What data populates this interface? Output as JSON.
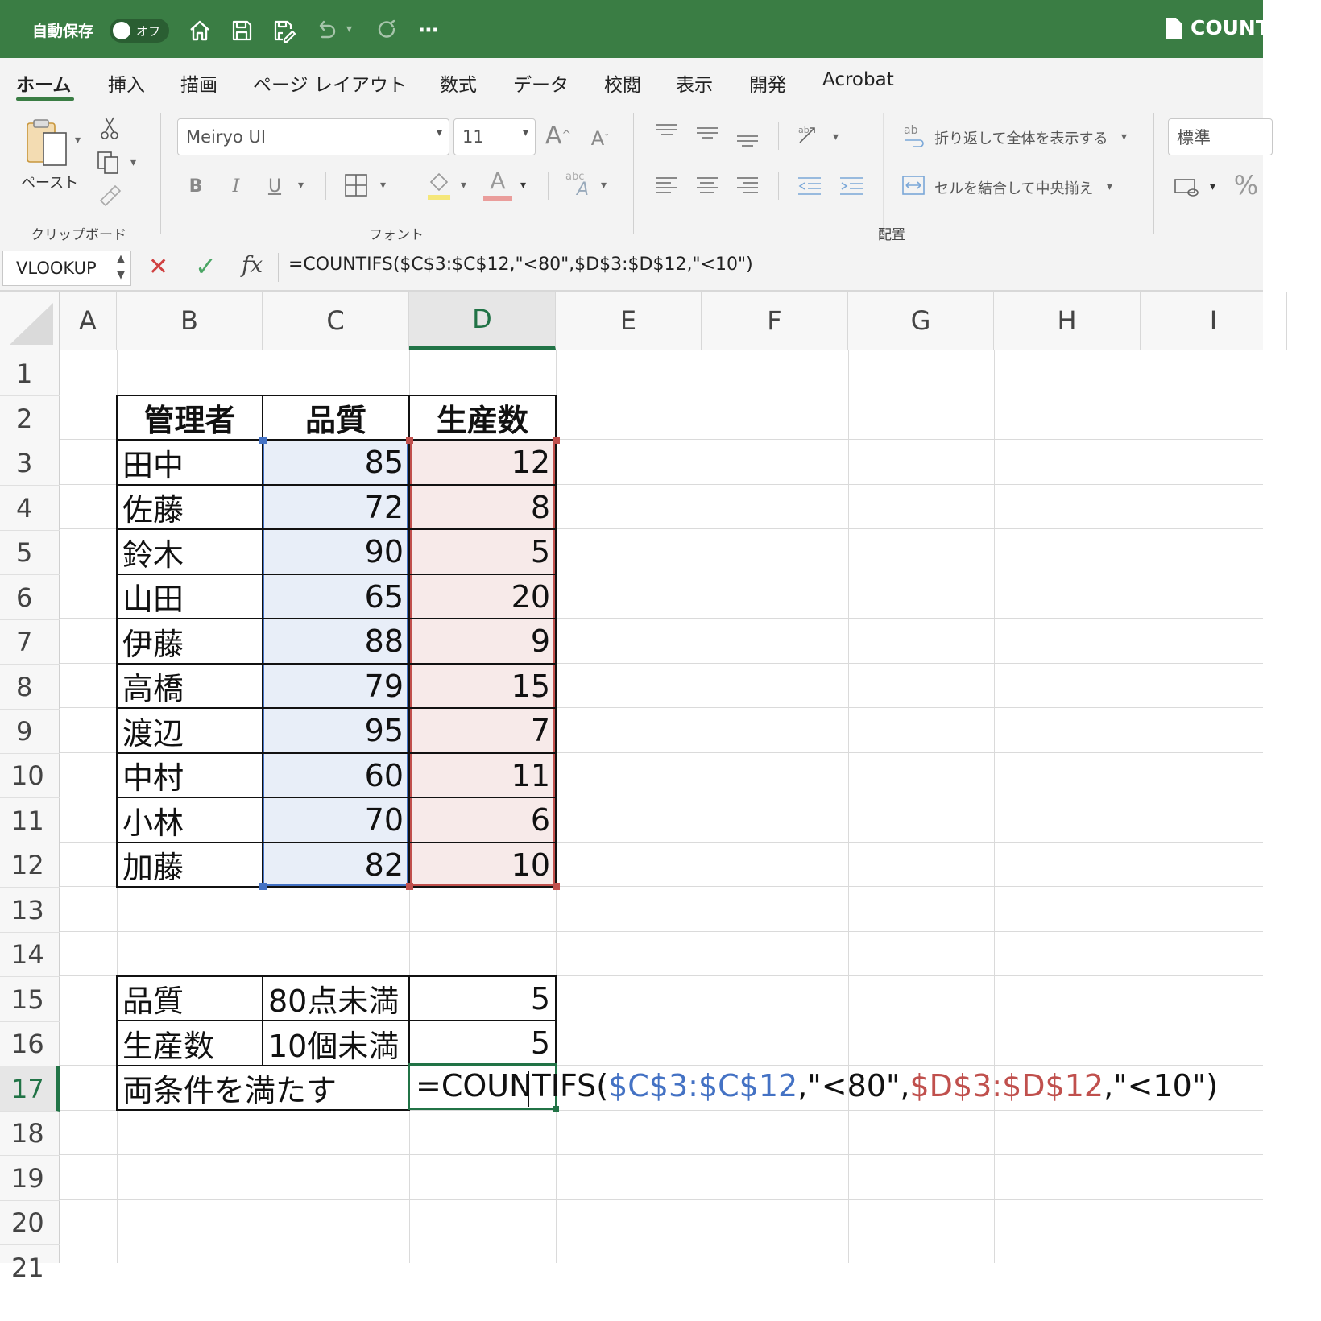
{
  "titlebar": {
    "autosave_label": "自動保存",
    "autosave_state": "オフ",
    "doc_title": "COUNT",
    "icons": [
      "home-icon",
      "save-icon",
      "save-as-icon",
      "undo-icon",
      "redo-icon",
      "more-icon"
    ]
  },
  "tabs": [
    {
      "label": "ホーム",
      "active": true
    },
    {
      "label": "挿入"
    },
    {
      "label": "描画"
    },
    {
      "label": "ページ レイアウト"
    },
    {
      "label": "数式"
    },
    {
      "label": "データ"
    },
    {
      "label": "校閲"
    },
    {
      "label": "表示"
    },
    {
      "label": "開発"
    },
    {
      "label": "Acrobat"
    }
  ],
  "ribbon": {
    "paste_label": "ペースト",
    "clipboard_group": "クリップボード",
    "font_group": "フォント",
    "alignment_group": "配置",
    "font_name": "Meiryo UI",
    "font_size": "11",
    "bold": "B",
    "italic": "I",
    "underline": "U",
    "wrap_text": "折り返して全体を表示する",
    "merge_center": "セルを結合して中央揃え",
    "number_format": "標準",
    "percent": "%",
    "grow_font": "A",
    "shrink_font": "A",
    "font_color": "A",
    "abc_label": "abc"
  },
  "formula_bar": {
    "name_box": "VLOOKUP",
    "fx": "fx",
    "formula": "=COUNTIFS($C$3:$C$12,\"<80\",$D$3:$D$12,\"<10\")"
  },
  "columns": [
    "A",
    "B",
    "C",
    "D",
    "E",
    "F",
    "G",
    "H",
    "I"
  ],
  "selected_column": "D",
  "rows": [
    "1",
    "2",
    "3",
    "4",
    "5",
    "6",
    "7",
    "8",
    "9",
    "10",
    "11",
    "12",
    "13",
    "14",
    "15",
    "16",
    "17",
    "18",
    "19",
    "20",
    "21"
  ],
  "selected_row": "17",
  "table": {
    "headers": [
      "管理者",
      "品質",
      "生産数"
    ],
    "records": [
      {
        "name": "田中",
        "quality": "85",
        "count": "12"
      },
      {
        "name": "佐藤",
        "quality": "72",
        "count": "8"
      },
      {
        "name": "鈴木",
        "quality": "90",
        "count": "5"
      },
      {
        "name": "山田",
        "quality": "65",
        "count": "20"
      },
      {
        "name": "伊藤",
        "quality": "88",
        "count": "9"
      },
      {
        "name": "高橋",
        "quality": "79",
        "count": "15"
      },
      {
        "name": "渡辺",
        "quality": "95",
        "count": "7"
      },
      {
        "name": "中村",
        "quality": "60",
        "count": "11"
      },
      {
        "name": "小林",
        "quality": "70",
        "count": "6"
      },
      {
        "name": "加藤",
        "quality": "82",
        "count": "10"
      }
    ]
  },
  "summary": [
    {
      "label": "品質",
      "condition": "80点未満",
      "result": "5"
    },
    {
      "label": "生産数",
      "condition": "10個未満",
      "result": "5"
    }
  ],
  "both_conditions": {
    "label": "両条件を満たす",
    "edit_parts": {
      "prefix": "=COUNTIFS(",
      "ref1": "$C$3:$C$12",
      "mid": ",\"<80\",",
      "ref2": "$D$3:$D$12",
      "suffix": ",\"<10\")"
    }
  },
  "colors": {
    "excel_green": "#3a7d44",
    "ref_blue": "#4472c4",
    "ref_red": "#c0504d"
  }
}
